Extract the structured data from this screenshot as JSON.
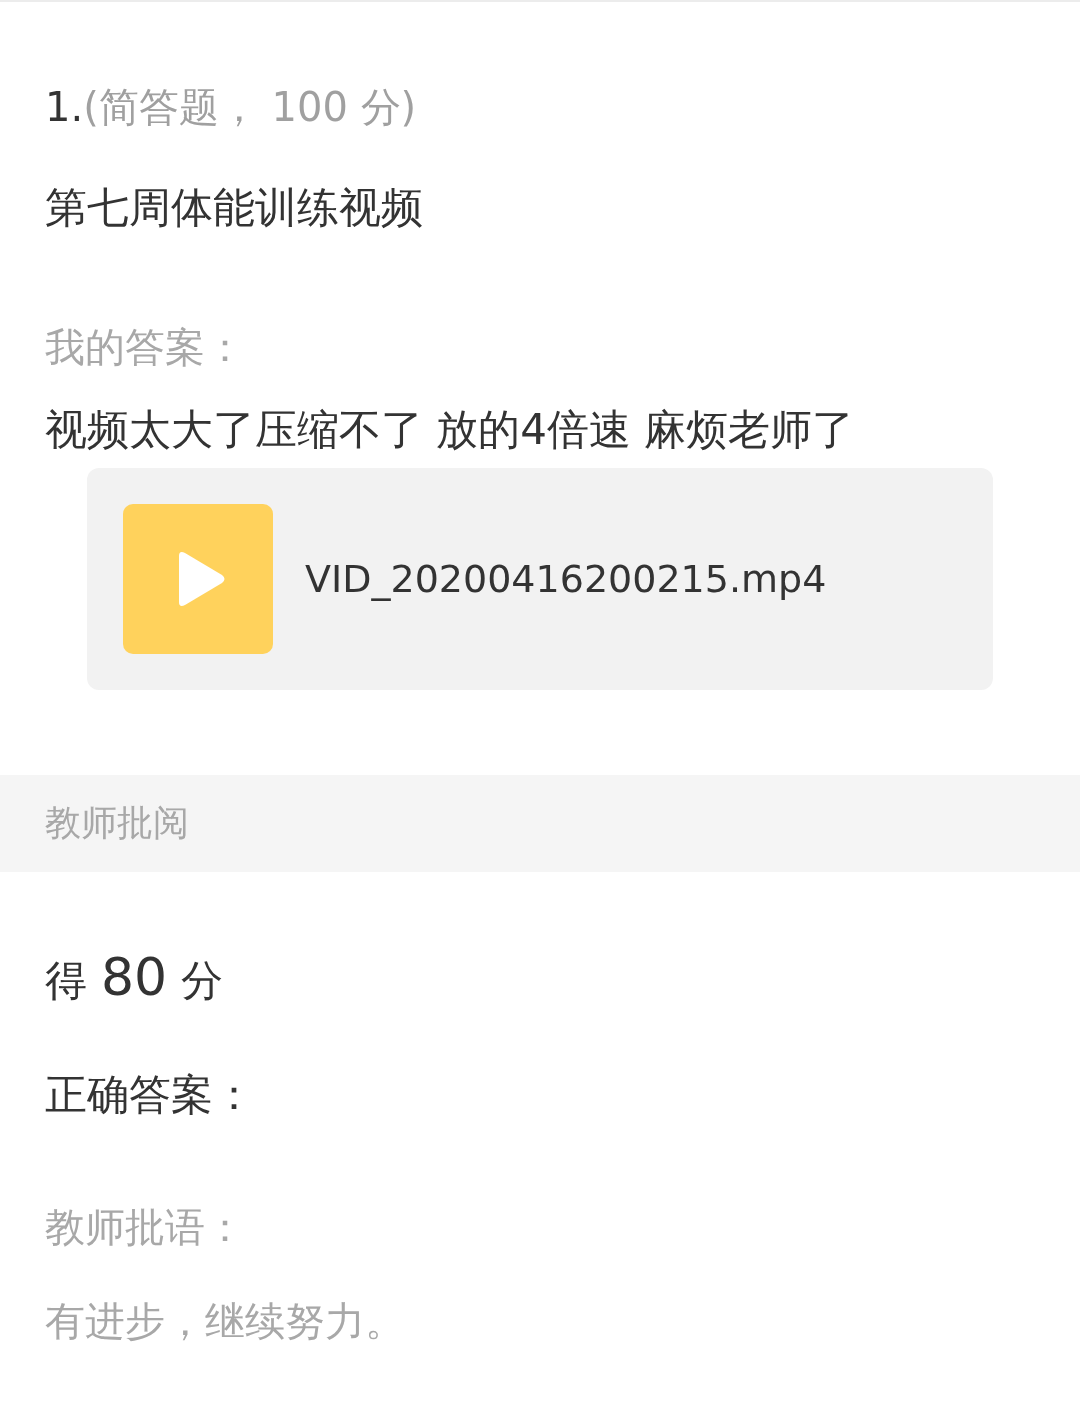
{
  "question": {
    "number": "1.",
    "type_label": "(简答题， 100 分)",
    "title": "第七周体能训练视频"
  },
  "my_answer": {
    "label": "我的答案：",
    "text": "视频太大了压缩不了 放的4倍速 麻烦老师了",
    "attachment": {
      "kind": "video",
      "file_name": "VID_20200416200215.mp4"
    }
  },
  "review_section": {
    "title": "教师批阅"
  },
  "score": {
    "prefix": "得",
    "value": "80",
    "suffix": "分"
  },
  "correct_answer": {
    "label": "正确答案："
  },
  "teacher_comment": {
    "label": "教师批语：",
    "text": "有进步，继续努力。"
  }
}
